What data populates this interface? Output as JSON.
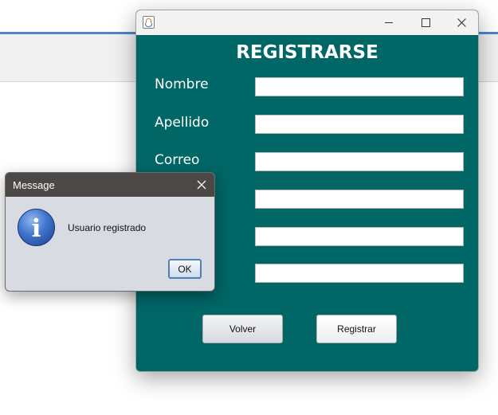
{
  "register_window": {
    "title": "REGISTRARSE",
    "fields": [
      {
        "label": "Nombre",
        "value": ""
      },
      {
        "label": "Apellido",
        "value": ""
      },
      {
        "label": "Correo",
        "value": ""
      },
      {
        "label": "",
        "value": ""
      },
      {
        "label": "",
        "value": ""
      },
      {
        "label": "",
        "value": ""
      }
    ],
    "buttons": {
      "back_label": "Volver",
      "register_label": "Registrar"
    },
    "colors": {
      "background": "#006666",
      "text": "#ffffff"
    },
    "icons": {
      "app": "java-icon",
      "minimize": "minimize-icon",
      "maximize": "maximize-icon",
      "close": "close-icon"
    }
  },
  "message_dialog": {
    "title": "Message",
    "text": "Usuario registrado",
    "ok_label": "OK",
    "icons": {
      "info": "info-icon",
      "close": "close-icon"
    }
  }
}
